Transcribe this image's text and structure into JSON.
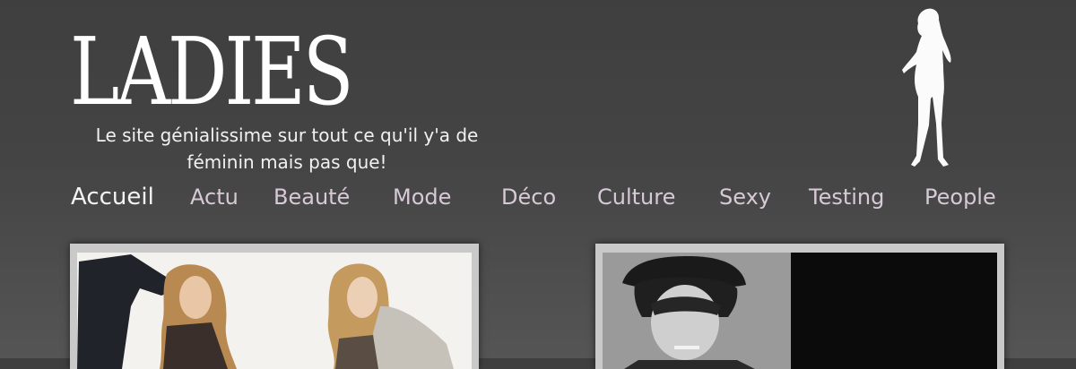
{
  "header": {
    "logo": "LADIES",
    "tagline": "Le site génialissime sur tout ce qu'il y'a de féminin mais pas que!",
    "silhouette_icon": "woman-silhouette-icon"
  },
  "nav": {
    "items": [
      {
        "label": "Accueil"
      },
      {
        "label": "Actu"
      },
      {
        "label": "Beauté"
      },
      {
        "label": "Mode"
      },
      {
        "label": "Déco"
      },
      {
        "label": "Culture"
      },
      {
        "label": "Sexy"
      },
      {
        "label": "Testing"
      },
      {
        "label": "People"
      }
    ]
  },
  "colors": {
    "background": "#444444",
    "nav_text": "#d8c9d6",
    "active_nav": "#f4f4f4"
  },
  "articles": [
    {
      "image": "fashion-photo-two-blonde-models"
    },
    {
      "image": "black-and-white-portrait-man-hat-cigarette"
    }
  ]
}
